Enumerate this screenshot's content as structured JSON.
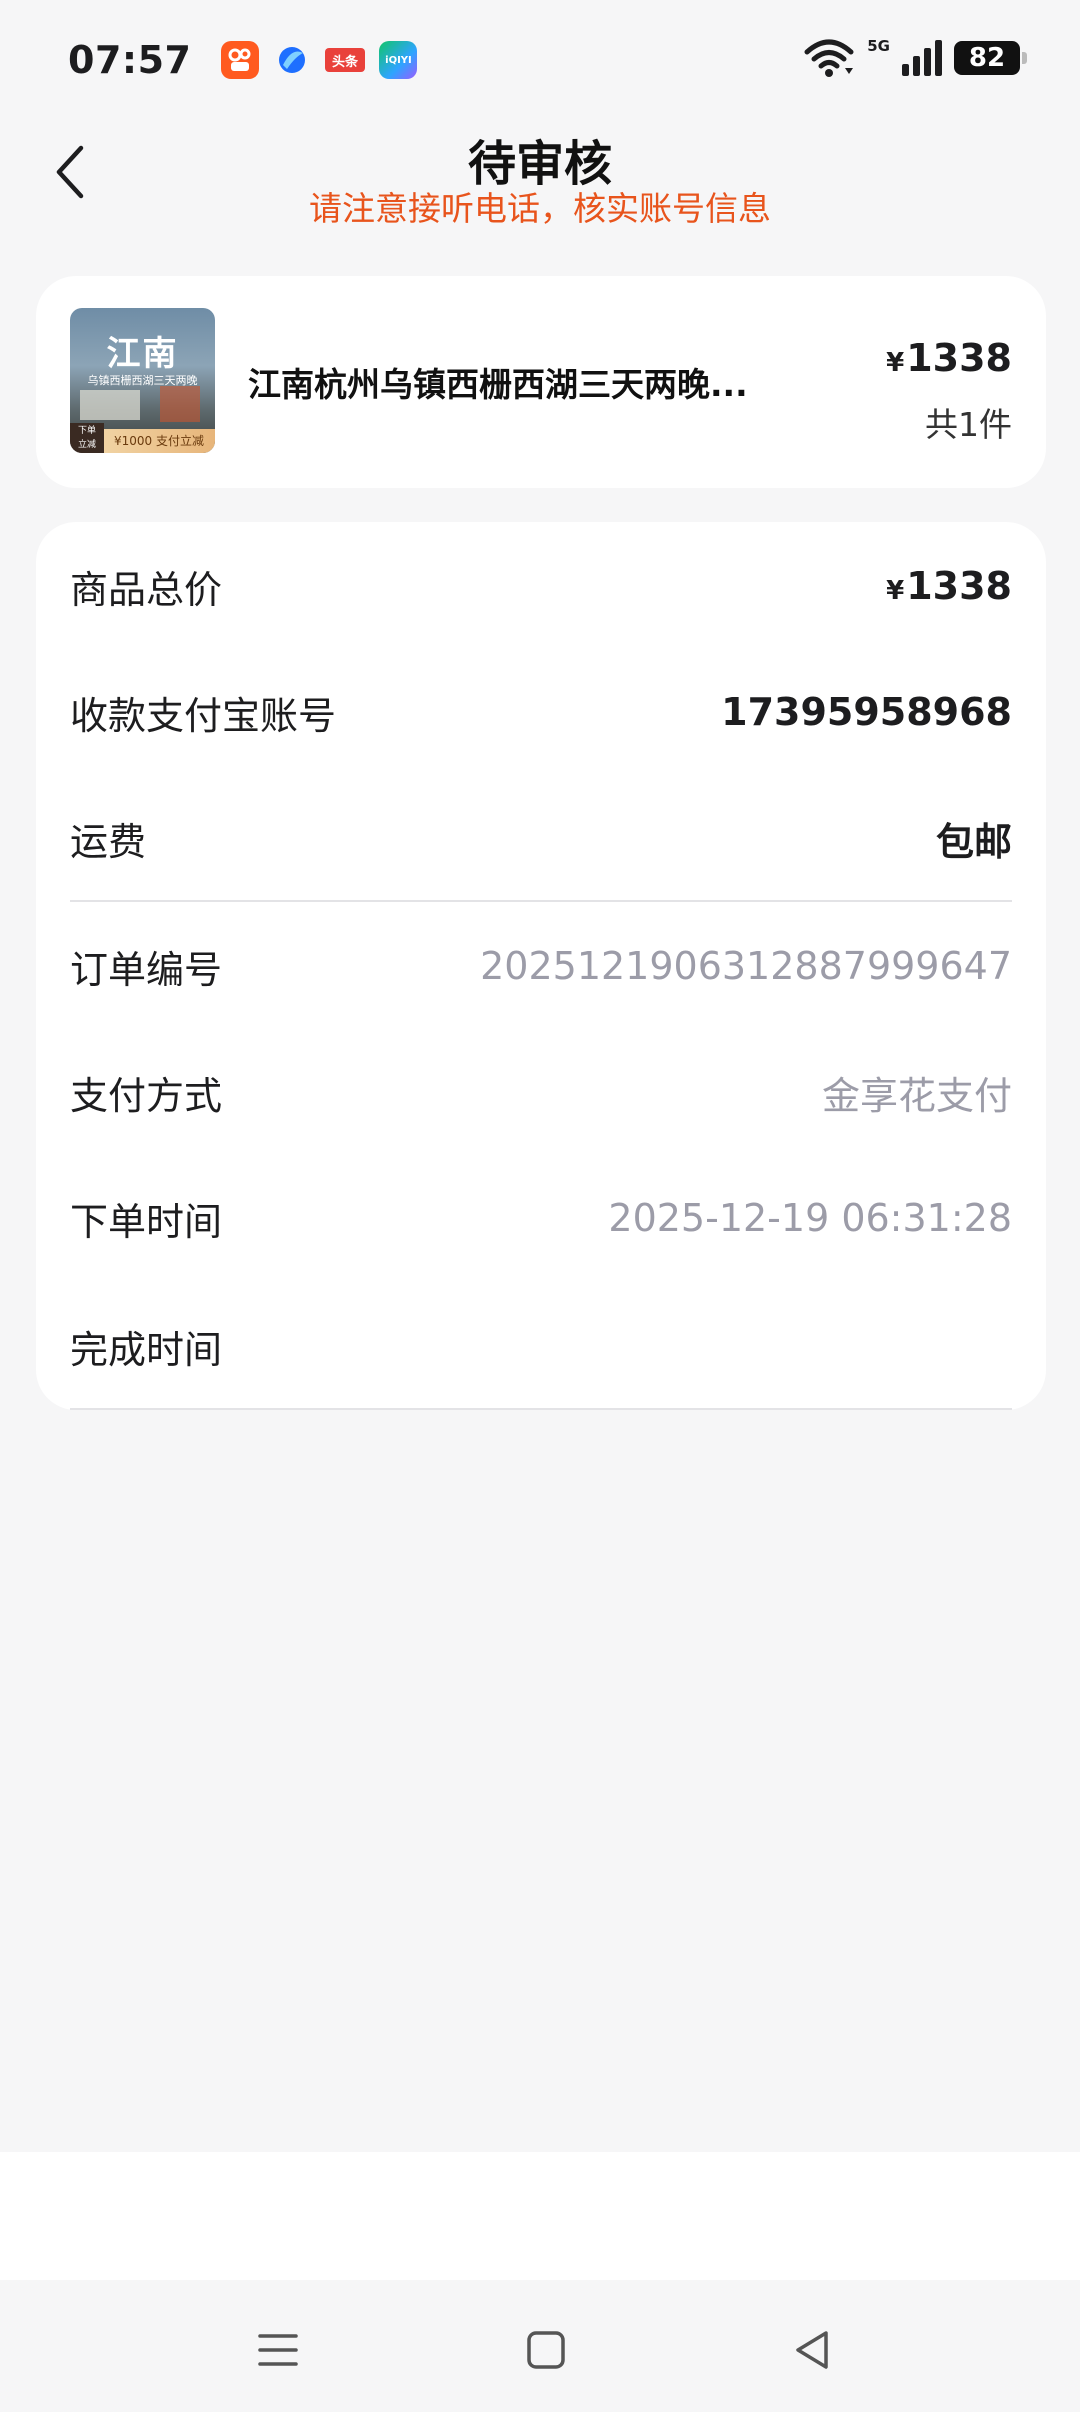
{
  "status_bar": {
    "time": "07:57",
    "apps": [
      "kuaishou-app",
      "browser-app",
      "toutiao-app",
      "iqiyi-app"
    ],
    "toutiao_label": "头条",
    "iqiyi_label": "iQIYI",
    "network": "5G",
    "battery": "82"
  },
  "header": {
    "title": "待审核",
    "subtitle": "请注意接听电话，核实账号信息",
    "accent_color": "#E8541C"
  },
  "product": {
    "thumb_title": "江南",
    "thumb_subtitle": "乌镇西栅西湖三天两晚",
    "thumb_tag_left": "下单\n立减",
    "thumb_tag_right": "¥1000 支付立减",
    "name": "江南杭州乌镇西栅西湖三天两晚...",
    "currency": "¥",
    "price": "1338",
    "count": "共1件"
  },
  "details": {
    "total_label": "商品总价",
    "total_currency": "¥",
    "total_value": "1338",
    "alipay_label": "收款支付宝账号",
    "alipay_value": "17395958968",
    "shipping_label": "运费",
    "shipping_value": "包邮",
    "order_no_label": "订单编号",
    "order_no_value": "2025121906312887999647",
    "pay_method_label": "支付方式",
    "pay_method_value": "金享花支付",
    "order_time_label": "下单时间",
    "order_time_value": "2025-12-19 06:31:28",
    "finish_time_label": "完成时间",
    "finish_time_value": ""
  },
  "nav": {
    "icons": [
      "menu-icon",
      "home-icon",
      "back-triangle-icon"
    ]
  }
}
